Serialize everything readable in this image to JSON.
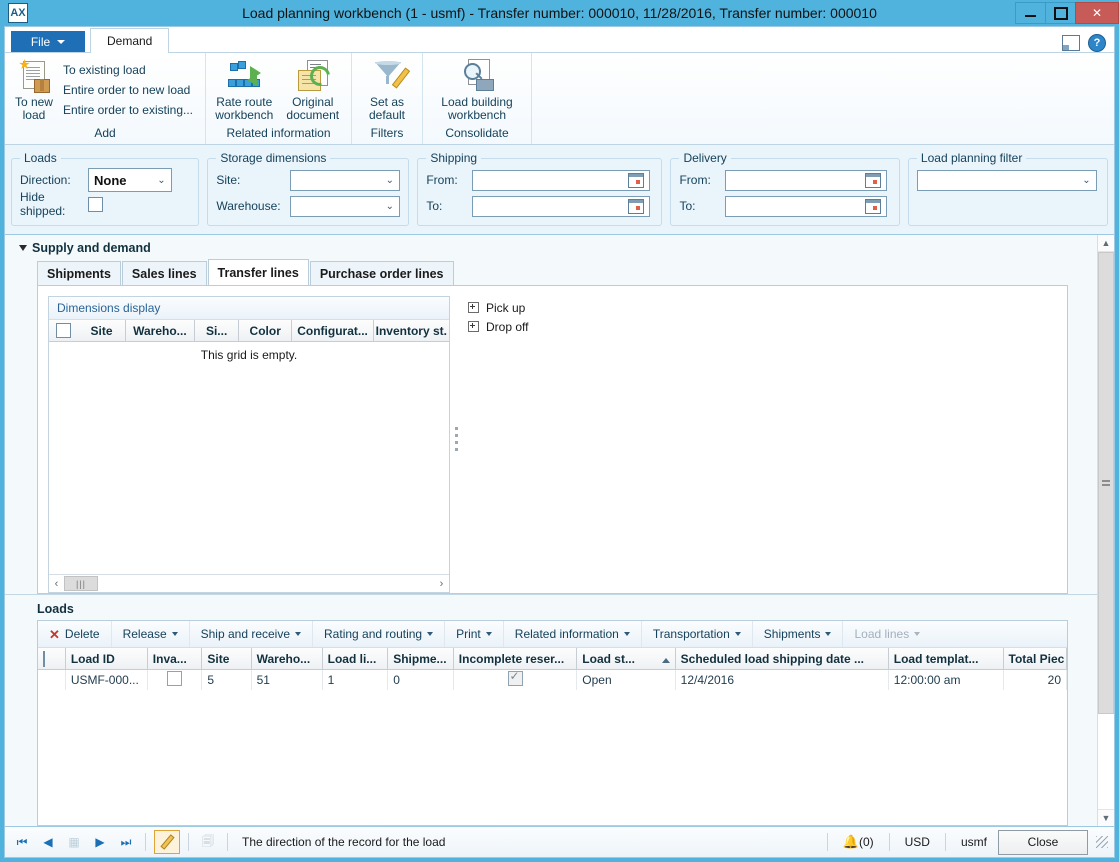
{
  "window": {
    "title": "Load planning workbench (1 - usmf) - Transfer number: 000010, 11/28/2016, Transfer number: 000010",
    "app_icon": "app-icon",
    "minimize": "minimize-button",
    "maximize": "maximize-button",
    "close": "close-button"
  },
  "ribbon": {
    "file_tab": "File",
    "tabs": [
      {
        "label": "Demand",
        "active": true
      }
    ],
    "groups": [
      {
        "title": "Add",
        "big_button": {
          "label_line1": "To new",
          "label_line2": "load",
          "icon": "new-document-box-icon"
        },
        "small_buttons": [
          "To existing load",
          "Entire order to new load",
          "Entire order to existing..."
        ]
      },
      {
        "title": "Related information",
        "buttons": [
          {
            "label_line1": "Rate route",
            "label_line2": "workbench",
            "icon": "route-network-icon"
          },
          {
            "label_line1": "Original",
            "label_line2": "document",
            "icon": "document-refresh-icon"
          }
        ]
      },
      {
        "title": "Filters",
        "buttons": [
          {
            "label_line1": "Set as",
            "label_line2": "default",
            "icon": "funnel-pencil-icon"
          }
        ]
      },
      {
        "title": "Consolidate",
        "buttons": [
          {
            "label_line1": "Load building",
            "label_line2": "workbench",
            "icon": "magnifier-truck-icon"
          }
        ]
      }
    ]
  },
  "filters": {
    "loads": {
      "legend": "Loads",
      "direction_label": "Direction:",
      "direction_value": "None",
      "hide_shipped_label": "Hide shipped:",
      "hide_shipped_checked": false
    },
    "storage": {
      "legend": "Storage dimensions",
      "site_label": "Site:",
      "site_value": "",
      "warehouse_label": "Warehouse:",
      "warehouse_value": ""
    },
    "shipping": {
      "legend": "Shipping",
      "from_label": "From:",
      "from_value": "",
      "to_label": "To:",
      "to_value": ""
    },
    "delivery": {
      "legend": "Delivery",
      "from_label": "From:",
      "from_value": "",
      "to_label": "To:",
      "to_value": ""
    },
    "load_planning_filter": {
      "legend": "Load planning filter",
      "value": ""
    }
  },
  "supply_demand": {
    "section_title": "Supply and demand",
    "tabs": [
      {
        "label": "Shipments",
        "active": false
      },
      {
        "label": "Sales lines",
        "active": false
      },
      {
        "label": "Transfer lines",
        "active": true
      },
      {
        "label": "Purchase order lines",
        "active": false
      }
    ],
    "dimensions_grid": {
      "title": "Dimensions display",
      "columns": [
        "Site",
        "Wareho...",
        "Si...",
        "Color",
        "Configurat...",
        "Inventory st."
      ],
      "empty_message": "This grid is empty.",
      "rows": []
    },
    "expanders": [
      {
        "label": "Pick up",
        "expanded": false
      },
      {
        "label": "Drop off",
        "expanded": false
      }
    ]
  },
  "loads": {
    "section_title": "Loads",
    "toolbar": [
      {
        "label": "Delete",
        "icon": "delete-x-icon",
        "has_menu": false,
        "disabled": false
      },
      {
        "label": "Release",
        "has_menu": true,
        "disabled": false
      },
      {
        "label": "Ship and receive",
        "has_menu": true,
        "disabled": false
      },
      {
        "label": "Rating and routing",
        "has_menu": true,
        "disabled": false
      },
      {
        "label": "Print",
        "has_menu": true,
        "disabled": false
      },
      {
        "label": "Related information",
        "has_menu": true,
        "disabled": false
      },
      {
        "label": "Transportation",
        "has_menu": true,
        "disabled": false
      },
      {
        "label": "Shipments",
        "has_menu": true,
        "disabled": false
      },
      {
        "label": "Load lines",
        "has_menu": true,
        "disabled": true
      }
    ],
    "columns": [
      {
        "label": "Load ID",
        "sorted": false
      },
      {
        "label": "Inva...",
        "sorted": false
      },
      {
        "label": "Site",
        "sorted": false
      },
      {
        "label": "Wareho...",
        "sorted": false
      },
      {
        "label": "Load li...",
        "sorted": false
      },
      {
        "label": "Shipme...",
        "sorted": false
      },
      {
        "label": "Incomplete reser...",
        "sorted": false
      },
      {
        "label": "Load st...",
        "sorted": true
      },
      {
        "label": "Scheduled load shipping date ...",
        "sorted": false
      },
      {
        "label": "Load templat...",
        "sorted": false
      },
      {
        "label": "Total Piec",
        "sorted": false
      }
    ],
    "rows": [
      {
        "load_id": "USMF-000...",
        "invalid": false,
        "site": "5",
        "warehouse": "51",
        "load_lines": "1",
        "shipments": "0",
        "incomplete_reservation": true,
        "load_status": "Open",
        "scheduled_date": "12/4/2016",
        "scheduled_time": "12:00:00 am",
        "load_template": "",
        "total_pieces": "20"
      }
    ]
  },
  "statusbar": {
    "nav": {
      "first": "first-record",
      "previous": "previous-record",
      "grid": "grid-view",
      "next": "next-record",
      "last": "last-record"
    },
    "edit_label": "edit-record",
    "copy_label": "copy-record",
    "message": "The direction of the record for the load",
    "notifications": "(0)",
    "currency": "USD",
    "company": "usmf",
    "close_button": "Close"
  }
}
